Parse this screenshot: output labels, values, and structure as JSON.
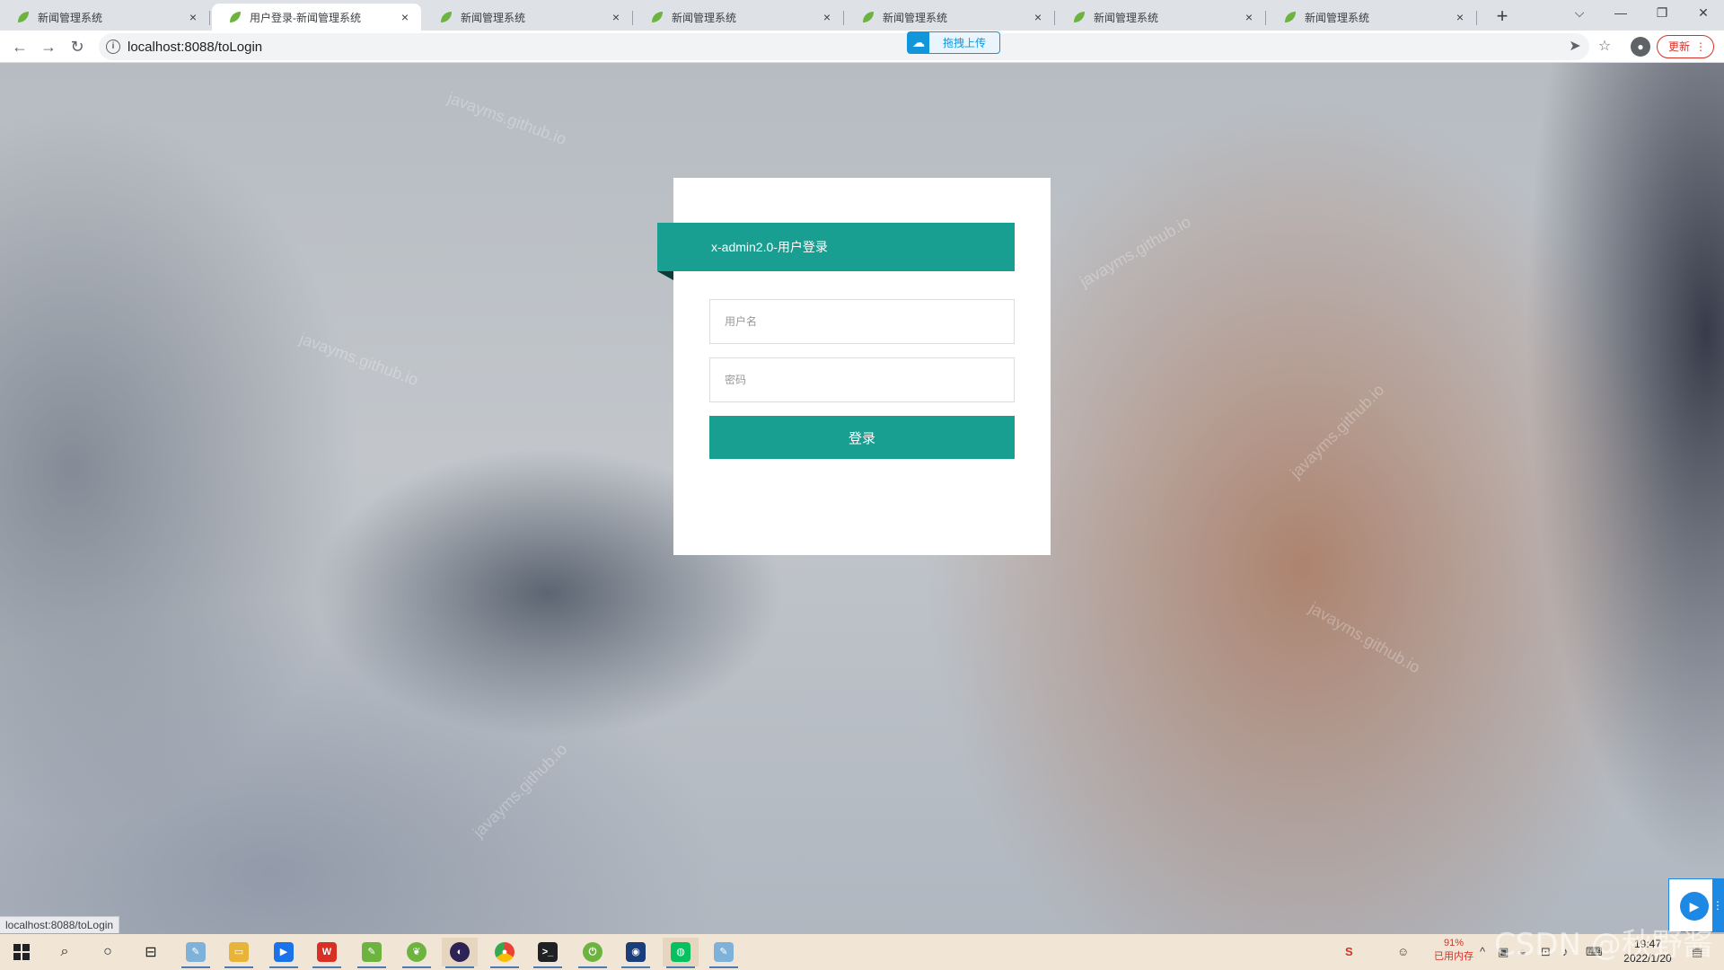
{
  "browser": {
    "tabs": [
      {
        "title": "新闻管理系统",
        "active": false
      },
      {
        "title": "用户登录-新闻管理系统",
        "active": true
      },
      {
        "title": "新闻管理系统",
        "active": false
      },
      {
        "title": "新闻管理系统",
        "active": false
      },
      {
        "title": "新闻管理系统",
        "active": false
      },
      {
        "title": "新闻管理系统",
        "active": false
      },
      {
        "title": "新闻管理系统",
        "active": false
      }
    ],
    "tab_close": "×",
    "new_tab": "+",
    "window_controls": {
      "dropdown": "⌵",
      "minimize": "—",
      "restore": "❐",
      "close": "✕"
    },
    "nav": {
      "back": "←",
      "forward": "→",
      "reload": "↻"
    },
    "url": "localhost:8088/toLogin",
    "upload_extension_label": "拖拽上传",
    "update_label": "更新",
    "update_menu": "⋮"
  },
  "login": {
    "title": "x-admin2.0-用户登录",
    "username_placeholder": "用户名",
    "password_placeholder": "密码",
    "submit_label": "登录"
  },
  "watermark_text": "javayms.github.io",
  "status_bar_url": "localhost:8088/toLogin",
  "tray": {
    "memory_percent": "91%",
    "memory_label": "已用内存",
    "time": "19:47",
    "date": "2022/1/20"
  },
  "overlay_watermark": "CSDN @秋野酱",
  "colors": {
    "accent": "#189f92",
    "accent_dark": "#0d3d38",
    "tab_bar": "#dee1e6",
    "taskbar": "#f1e6d6"
  }
}
